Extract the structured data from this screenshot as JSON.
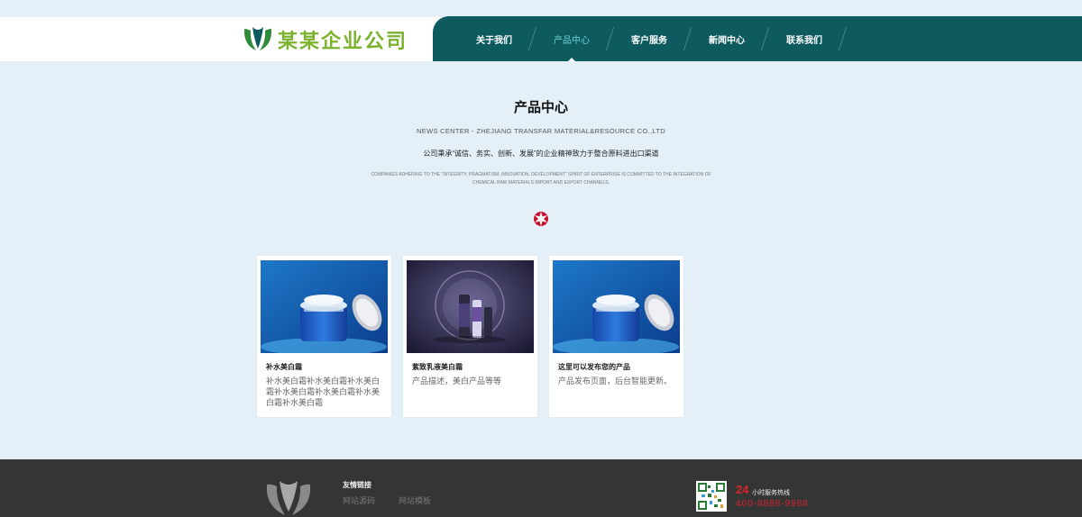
{
  "header": {
    "logo_text": "某某企业公司",
    "nav": [
      {
        "label": "关于我们",
        "active": false
      },
      {
        "label": "产品中心",
        "active": true
      },
      {
        "label": "客户服务",
        "active": false
      },
      {
        "label": "新闻中心",
        "active": false
      },
      {
        "label": "联系我们",
        "active": false
      }
    ]
  },
  "section": {
    "title": "产品中心",
    "subtitle_en": "NEWS CENTER - ZHEJIANG TRANSFAR MATERIAL&RESOURCE CO.,LTD",
    "description": "公司秉承“诚信、务实、创新、发展”的企业精神致力于整合原料进出口渠道",
    "description_en": "COMPANIES ADHERING TO THE \"INTEGRITY, PRAGMATISM, INNOVATION, DEVELOPMENT\" SPIRIT OF ENTERPRISE IS COMMITTED TO THE INTEGRATION OF CHEMICAL RAW MATERIALS IMPORT AND EXPORT CHANNELS."
  },
  "products": [
    {
      "title": "补水美白霜",
      "description": "补水美白霜补水美白霜补水美白霜补水美白霜补水美白霜补水美白霜补水美白霜",
      "image": "blue-cream-jar"
    },
    {
      "title": "紫致乳液美白霜",
      "description": "产品描述，美白产品等等",
      "image": "purple-lotion-set"
    },
    {
      "title": "这里可以发布您的产品",
      "description": "产品发布页面，后台智能更新。",
      "image": "blue-cream-jar"
    }
  ],
  "footer": {
    "links_title": "友情链接",
    "links": [
      "网站源码",
      "网站模板"
    ],
    "hotline_hours": "24",
    "hotline_label": "小时服务热线",
    "hotline_phone": "400-8888-9988"
  },
  "colors": {
    "page_bg": "#e4eff8",
    "nav_bg": "#0d5a5f",
    "nav_active": "#6fd2d0",
    "logo_green": "#7ab32e",
    "footer_bg": "#353535",
    "hotline_red": "#d8232a"
  }
}
